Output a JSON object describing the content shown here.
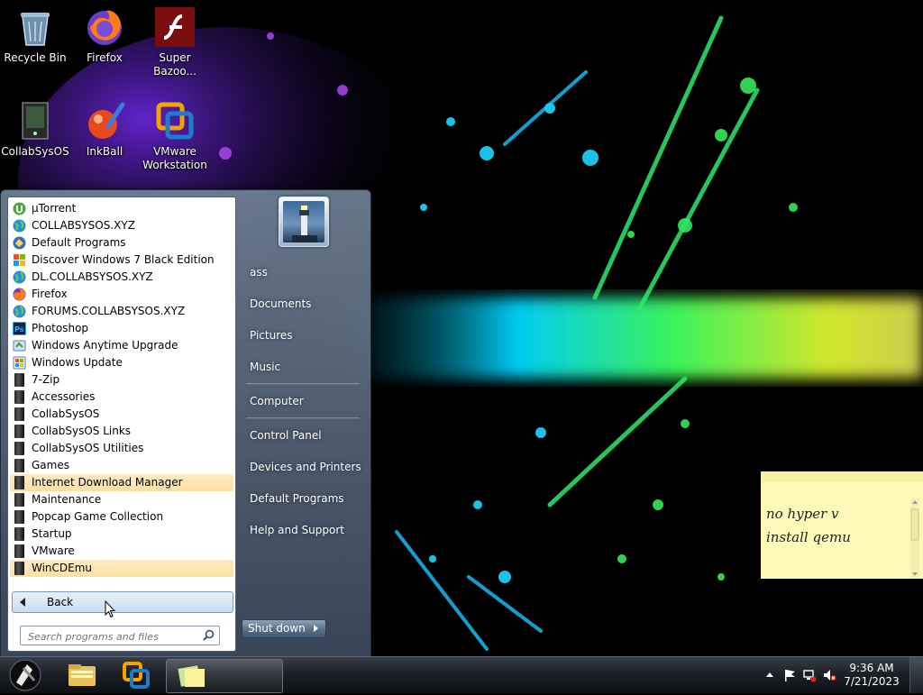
{
  "desktop": {
    "icons": [
      {
        "label": "Recycle Bin",
        "icon": "recycle-bin-icon"
      },
      {
        "label": "Firefox",
        "icon": "firefox-icon"
      },
      {
        "label": "Super Bazoo...",
        "icon": "flash-icon"
      },
      {
        "label": "CollabSysOS",
        "icon": "collabsysos-icon"
      },
      {
        "label": "InkBall",
        "icon": "inkball-icon"
      },
      {
        "label": "VMware Workstation",
        "icon": "vmware-icon"
      }
    ]
  },
  "start_menu": {
    "programs": [
      {
        "label": "µTorrent",
        "icon": "utorrent-icon"
      },
      {
        "label": "COLLABSYSOS.XYZ",
        "icon": "globe-icon"
      },
      {
        "label": "Default Programs",
        "icon": "default-programs-icon"
      },
      {
        "label": "Discover Windows 7 Black Edition",
        "icon": "windows-logo-icon"
      },
      {
        "label": "DL.COLLABSYSOS.XYZ",
        "icon": "globe-icon"
      },
      {
        "label": "Firefox",
        "icon": "firefox-icon"
      },
      {
        "label": "FORUMS.COLLABSYSOS.XYZ",
        "icon": "globe-icon"
      },
      {
        "label": "Photoshop",
        "icon": "photoshop-icon"
      },
      {
        "label": "Windows Anytime Upgrade",
        "icon": "anytime-upgrade-icon"
      },
      {
        "label": "Windows Update",
        "icon": "windows-update-icon"
      },
      {
        "label": "7-Zip",
        "icon": "folder-icon"
      },
      {
        "label": "Accessories",
        "icon": "folder-icon"
      },
      {
        "label": "CollabSysOS",
        "icon": "folder-icon"
      },
      {
        "label": "CollabSysOS Links",
        "icon": "folder-icon"
      },
      {
        "label": "CollabSysOS Utilities",
        "icon": "folder-icon"
      },
      {
        "label": "Games",
        "icon": "folder-icon"
      },
      {
        "label": "Internet Download Manager",
        "icon": "folder-icon",
        "highlighted": true
      },
      {
        "label": "Maintenance",
        "icon": "folder-icon"
      },
      {
        "label": "Popcap Game Collection",
        "icon": "folder-icon"
      },
      {
        "label": "Startup",
        "icon": "folder-icon"
      },
      {
        "label": "VMware",
        "icon": "folder-icon"
      },
      {
        "label": "WinCDEmu",
        "icon": "folder-icon",
        "highlighted": true
      }
    ],
    "back_label": "Back",
    "search_placeholder": "Search programs and files",
    "user_name": "ass",
    "right_items": [
      "Documents",
      "Pictures",
      "Music",
      "Computer",
      "Control Panel",
      "Devices and Printers",
      "Default Programs",
      "Help and Support"
    ],
    "shutdown_label": "Shut down"
  },
  "sticky_note": {
    "text": "no hyper v\ninstall qemu"
  },
  "taskbar": {
    "pinned": [
      {
        "name": "explorer",
        "icon": "file-explorer-icon"
      },
      {
        "name": "vmware",
        "icon": "vmware-icon"
      },
      {
        "name": "sticky-notes",
        "icon": "sticky-notes-icon",
        "active": true
      }
    ],
    "clock": {
      "time": "9:36 AM",
      "date": "7/21/2023"
    }
  },
  "colors": {
    "highlight": "#fbe4ac",
    "menu_glass": "#6b7f96",
    "sticky": "#fdf9b8"
  }
}
